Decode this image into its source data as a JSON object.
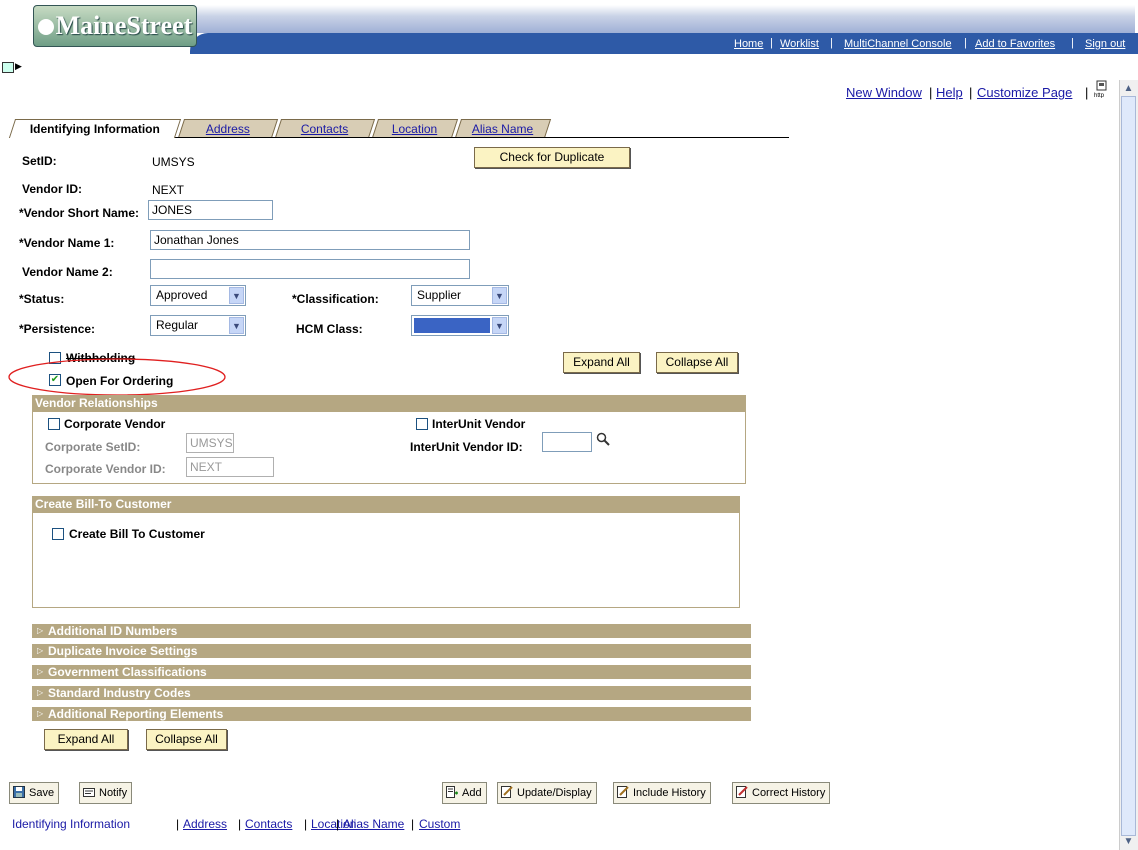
{
  "header": {
    "logo_text": "MaineStreet",
    "nav": [
      "Home",
      "Worklist",
      "MultiChannel Console",
      "Add to Favorites",
      "Sign out"
    ]
  },
  "top_links": {
    "new_window": "New Window",
    "help": "Help",
    "customize": "Customize Page",
    "http_icon": "http-icon"
  },
  "tabs": [
    "Identifying Information",
    "Address",
    "Contacts",
    "Location",
    "Alias Name"
  ],
  "form": {
    "setid_label": "SetID:",
    "setid_value": "UMSYS",
    "check_duplicate": "Check for Duplicate",
    "vendor_id_label": "Vendor ID:",
    "vendor_id_value": "NEXT",
    "short_name_label": "*Vendor Short Name:",
    "short_name_value": "JONES",
    "name1_label": "*Vendor Name 1:",
    "name1_value": "Jonathan Jones",
    "name2_label": "Vendor Name 2:",
    "name2_value": "",
    "status_label": "*Status:",
    "status_value": "Approved",
    "classification_label": "*Classification:",
    "classification_value": "Supplier",
    "persistence_label": "*Persistence:",
    "persistence_value": "Regular",
    "hcm_label": "HCM Class:",
    "hcm_value": "",
    "withholding_label": "Withholding",
    "withholding_checked": false,
    "open_ordering_label": "Open For Ordering",
    "open_ordering_checked": true,
    "expand_all": "Expand All",
    "collapse_all": "Collapse All"
  },
  "vendor_relationships": {
    "title": "Vendor Relationships",
    "corporate_vendor": "Corporate Vendor",
    "corporate_setid_label": "Corporate SetID:",
    "corporate_setid_value": "UMSYS",
    "corporate_vendor_id_label": "Corporate Vendor ID:",
    "corporate_vendor_id_value": "NEXT",
    "interunit_vendor": "InterUnit Vendor",
    "interunit_vendor_id_label": "InterUnit Vendor ID:",
    "interunit_vendor_id_value": ""
  },
  "bill_to": {
    "title": "Create Bill-To Customer",
    "checkbox": "Create Bill To Customer"
  },
  "collapsibles": [
    "Additional ID Numbers",
    "Duplicate Invoice Settings",
    "Government Classifications",
    "Standard Industry Codes",
    "Additional Reporting Elements"
  ],
  "bottom_expand_all": "Expand All",
  "bottom_collapse_all": "Collapse All",
  "toolbar": {
    "save": "Save",
    "notify": "Notify",
    "add": "Add",
    "update_display": "Update/Display",
    "include_history": "Include History",
    "correct_history": "Correct History"
  },
  "bottom_links": [
    "Identifying Information",
    "Address",
    "Contacts",
    "Location",
    "Alias Name",
    "Custom"
  ]
}
